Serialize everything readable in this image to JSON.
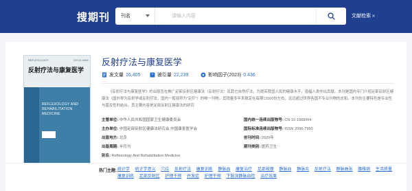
{
  "header": {
    "brand": "搜期刊",
    "search_scope": "刊名",
    "search_placeholder": "请输入内容",
    "advanced_link": "文献检索 »"
  },
  "journal": {
    "title": "反射疗法与康复医学",
    "cover": {
      "top_left_text": "REFLEXOLOGY",
      "top_right_text": "CN 10-1669",
      "title_cn": "反射疗法与康复医学",
      "title_en": "REFLEXOLOGY AND REHABILITATION MEDICINE"
    },
    "stats": {
      "articles_label": "发文量",
      "articles_value": "16,405",
      "cited_label": "被引量",
      "cited_value": "22,239",
      "impact_label": "影响因子(2023)",
      "impact_value": "0.436"
    },
    "intro": "《反射疗法与康复医学》的出版旨在推广足部反射区健康法（反射疗法）及其它自然疗法，为提高我国人民的健康水平，造福人类作出贡献。本刊是国内专门介绍足部反射区健康法（国外称为反射学或反射疗法，国内一般简称为“足疗”）的唯一刊物。其销量多年来稳定在每期12000份左右，远远超过世界各国不专业刊物的总和。本刊的主要特色是专业性与普及性的结合。其主要内容是足部反射区健康法的研究",
    "info": {
      "sponsor_label": "主管单位:",
      "sponsor_value": "中华人民共和国国家卫生健康委员会",
      "host_label": "主办单位:",
      "host_value": "中国足部反射区健康法研究会,中国康复医学会",
      "location_label": "出版地方:",
      "location_value": "北京",
      "frequency_label": "出版周期:",
      "frequency_value": "半月刊",
      "alias_label": "别名:",
      "alias_value": "Reflexology And Rehabilitation Medicine",
      "cn_label": "国内统一连续出版物号:",
      "cn_value": "CN 10-1669/R4",
      "issn_label": "国际标准连续出版物号:",
      "issn_value": "ISSN 2096-7950",
      "founded_label": "创刊时间:",
      "founded_value": "2020年",
      "category_label": "期刊类别:",
      "category_value": "医药卫生"
    },
    "hot_topics_label": "热门主题:",
    "hot_topics": [
      "统计学",
      "统计学意义",
      "穴位",
      "反射疗法",
      "康复训练",
      "静脉血",
      "康复治疗",
      "足部按摩",
      "静脉血",
      "静脉炎",
      "反射疗法",
      "静脉曲张",
      "腰椎病",
      "生活质量",
      "康复训练",
      "足部反射区",
      "护理干预",
      "并发症",
      "护理干预",
      "下肢深静脉血栓",
      "治疗效果"
    ]
  },
  "colors": {
    "header_bg": "#1f3f8f",
    "accent": "#2b6fd1",
    "page_bg": "#f3f4f7"
  }
}
